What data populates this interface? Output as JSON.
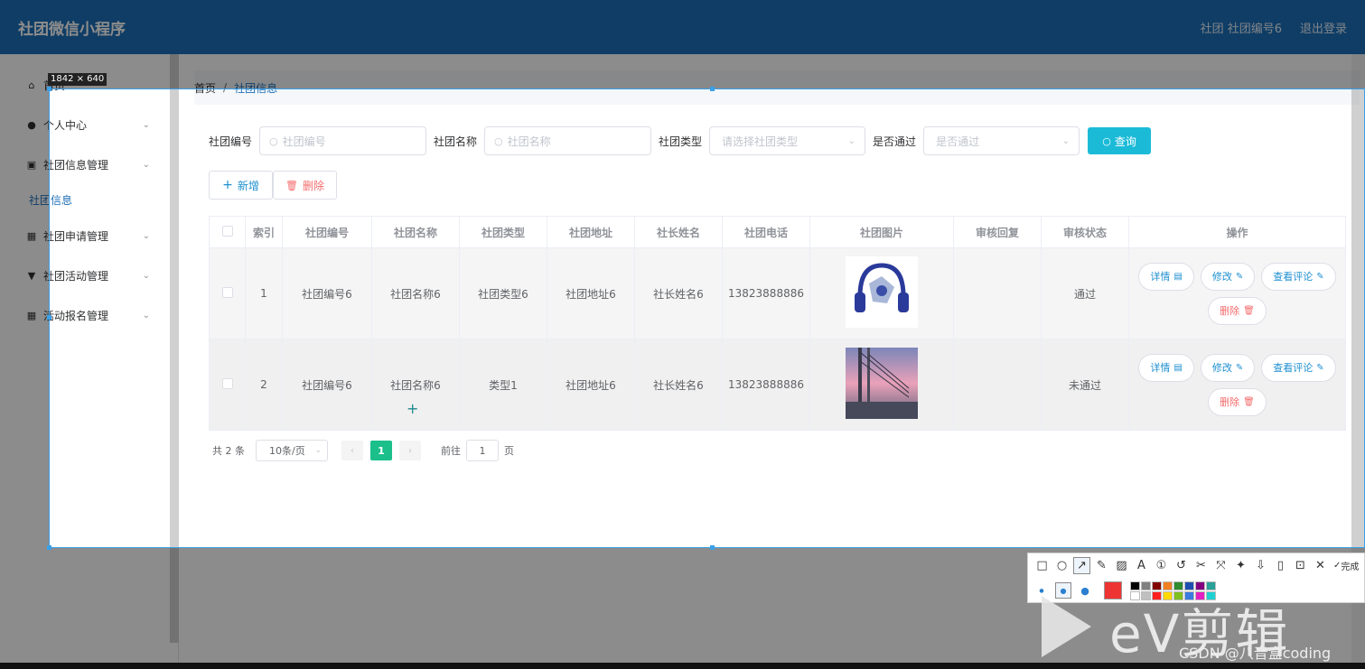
{
  "app": {
    "title": "社团微信小程序"
  },
  "header": {
    "user_text": "社团 社团编号6",
    "logout": "退出登录"
  },
  "sidebar": {
    "items": [
      {
        "label": "首页",
        "icon": "home-icon"
      },
      {
        "label": "个人中心",
        "icon": "user-icon"
      },
      {
        "label": "社团信息管理",
        "icon": "bag-icon"
      },
      {
        "label": "社团申请管理",
        "icon": "grid-icon"
      },
      {
        "label": "社团活动管理",
        "icon": "trophy-icon"
      },
      {
        "label": "活动报名管理",
        "icon": "grid-icon"
      }
    ],
    "active_sub": "社团信息"
  },
  "breadcrumb": {
    "home": "首页",
    "sep": "/",
    "current": "社团信息"
  },
  "search": {
    "club_no_label": "社团编号",
    "club_no_placeholder": "社团编号",
    "club_name_label": "社团名称",
    "club_name_placeholder": "社团名称",
    "club_type_label": "社团类型",
    "club_type_placeholder": "请选择社团类型",
    "approved_label": "是否通过",
    "approved_placeholder": "是否通过",
    "query": "查询"
  },
  "actions": {
    "add": "新增",
    "delete": "删除"
  },
  "table": {
    "headers": [
      "索引",
      "社团编号",
      "社团名称",
      "社团类型",
      "社团地址",
      "社长姓名",
      "社团电话",
      "社团图片",
      "审核回复",
      "审核状态",
      "操作"
    ],
    "rows": [
      {
        "index": "1",
        "club_no": "社团编号6",
        "name": "社团名称6",
        "type": "社团类型6",
        "address": "社团地址6",
        "leader": "社长姓名6",
        "phone": "13823888886",
        "reply": "",
        "status": "通过"
      },
      {
        "index": "2",
        "club_no": "社团编号6",
        "name": "社团名称6",
        "type": "类型1",
        "address": "社团地址6",
        "leader": "社长姓名6",
        "phone": "13823888886",
        "reply": "",
        "status": "未通过"
      }
    ],
    "op_labels": {
      "detail": "详情",
      "edit": "修改",
      "comments": "查看评论",
      "delete": "删除"
    }
  },
  "pagination": {
    "total": "共 2 条",
    "page_size": "10条/页",
    "current": "1",
    "goto_label": "前往",
    "goto_value": "1",
    "page_unit": "页"
  },
  "overlay": {
    "size_badge": "1842 × 640",
    "done": "完成"
  },
  "watermark": {
    "brand": "eV剪辑",
    "csdn": "CSDN @八音盒coding"
  }
}
